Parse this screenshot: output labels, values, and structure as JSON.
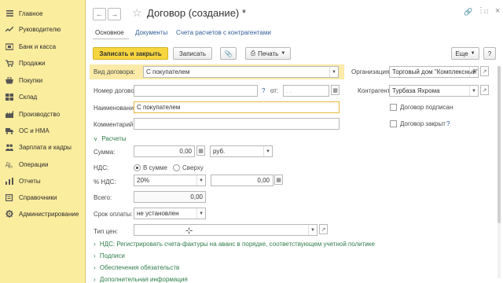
{
  "sidebar": {
    "items": [
      {
        "label": "Главное",
        "icon": "menu-icon"
      },
      {
        "label": "Руководителю",
        "icon": "trend-icon"
      },
      {
        "label": "Банк и касса",
        "icon": "bank-icon"
      },
      {
        "label": "Продажи",
        "icon": "cart-icon"
      },
      {
        "label": "Покупки",
        "icon": "basket-icon"
      },
      {
        "label": "Склад",
        "icon": "warehouse-icon"
      },
      {
        "label": "Производство",
        "icon": "factory-icon"
      },
      {
        "label": "ОС и НМА",
        "icon": "truck-icon"
      },
      {
        "label": "Зарплата и кадры",
        "icon": "people-icon"
      },
      {
        "label": "Операции",
        "icon": "operations-icon"
      },
      {
        "label": "Отчеты",
        "icon": "reports-icon"
      },
      {
        "label": "Справочники",
        "icon": "book-icon"
      },
      {
        "label": "Администрирование",
        "icon": "gear-icon"
      }
    ],
    "color": "#fbed9e"
  },
  "header": {
    "title": "Договор (создание) *",
    "tabs": [
      "Основное",
      "Документы",
      "Счета расчетов с контрагентами"
    ]
  },
  "toolbar": {
    "save_close": "Записать и закрыть",
    "save": "Записать",
    "print": "Печать",
    "more": "Еще"
  },
  "form": {
    "contract_type_label": "Вид договора:",
    "contract_type_value": "С покупателем",
    "org_label": "Организация:",
    "org_value": "Торговый дом \"Комплексный\"",
    "number_label": "Номер договора:",
    "number_value": "",
    "number_q": "?",
    "date_label": "от:",
    "date_value": ". .",
    "counterparty_label": "Контрагент:",
    "counterparty_value": "Турбаза Яхрома",
    "name_label": "Наименование:",
    "name_value": "С покупателем",
    "signed_label": "Договор подписан",
    "comment_label": "Комментарий:",
    "comment_value": "",
    "closed_label": "Договор закрыт",
    "closed_q": "?"
  },
  "settlements": {
    "section_title": "Расчеты",
    "sum_label": "Сумма:",
    "sum_value": "0,00",
    "currency": "руб.",
    "vat_label": "НДС:",
    "vat_in_sum": "В сумме",
    "vat_on_top": "Сверху",
    "vat_percent_label": "% НДС:",
    "vat_percent_value": "20%",
    "vat_amount_value": "0,00",
    "total_label": "Всего:",
    "total_value": "0,00",
    "payment_term_label": "Срок оплаты:",
    "payment_term_value": "не установлен",
    "price_type_label": "Тип цен:",
    "price_type_value": ""
  },
  "sections": {
    "vat_section": "НДС: Регистрировать счета-фактуры на аванс в порядке, соответствующем учетной политике",
    "signatures": "Подписи",
    "obligations": "Обеспечения обязательств",
    "extra": "Дополнительная информация"
  }
}
